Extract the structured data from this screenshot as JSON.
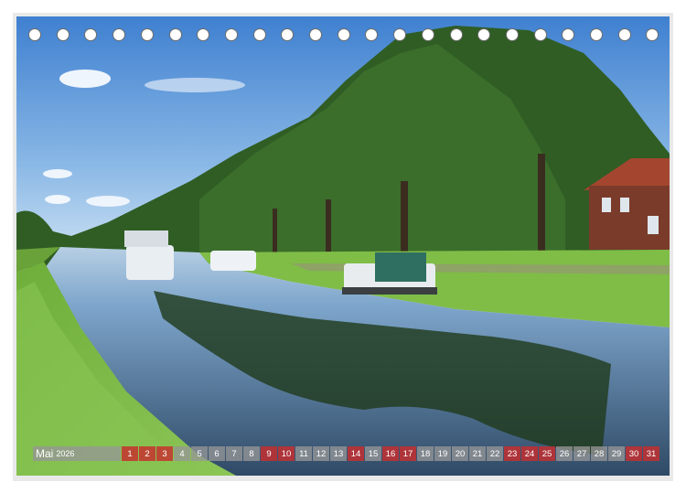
{
  "calendar": {
    "month": "Mai",
    "year": "2026",
    "days": [
      {
        "n": "1",
        "hl": true
      },
      {
        "n": "2",
        "hl": true
      },
      {
        "n": "3",
        "hl": true
      },
      {
        "n": "4",
        "hl": false
      },
      {
        "n": "5",
        "hl": false
      },
      {
        "n": "6",
        "hl": false
      },
      {
        "n": "7",
        "hl": false
      },
      {
        "n": "8",
        "hl": false
      },
      {
        "n": "9",
        "hl": true
      },
      {
        "n": "10",
        "hl": true
      },
      {
        "n": "11",
        "hl": false
      },
      {
        "n": "12",
        "hl": false
      },
      {
        "n": "13",
        "hl": false
      },
      {
        "n": "14",
        "hl": true
      },
      {
        "n": "15",
        "hl": false
      },
      {
        "n": "16",
        "hl": true
      },
      {
        "n": "17",
        "hl": true
      },
      {
        "n": "18",
        "hl": false
      },
      {
        "n": "19",
        "hl": false
      },
      {
        "n": "20",
        "hl": false
      },
      {
        "n": "21",
        "hl": false
      },
      {
        "n": "22",
        "hl": false
      },
      {
        "n": "23",
        "hl": true
      },
      {
        "n": "24",
        "hl": true
      },
      {
        "n": "25",
        "hl": true
      },
      {
        "n": "26",
        "hl": false
      },
      {
        "n": "27",
        "hl": false
      },
      {
        "n": "28",
        "hl": false
      },
      {
        "n": "29",
        "hl": false
      },
      {
        "n": "30",
        "hl": true
      },
      {
        "n": "31",
        "hl": true
      }
    ]
  },
  "colors": {
    "weekday_cell": "#969696",
    "highlight_cell": "#c82d2d",
    "sky": "#5a93d6",
    "grass": "#7dbb46",
    "water": "#3d4f63"
  },
  "spiral_hole_count": 23
}
